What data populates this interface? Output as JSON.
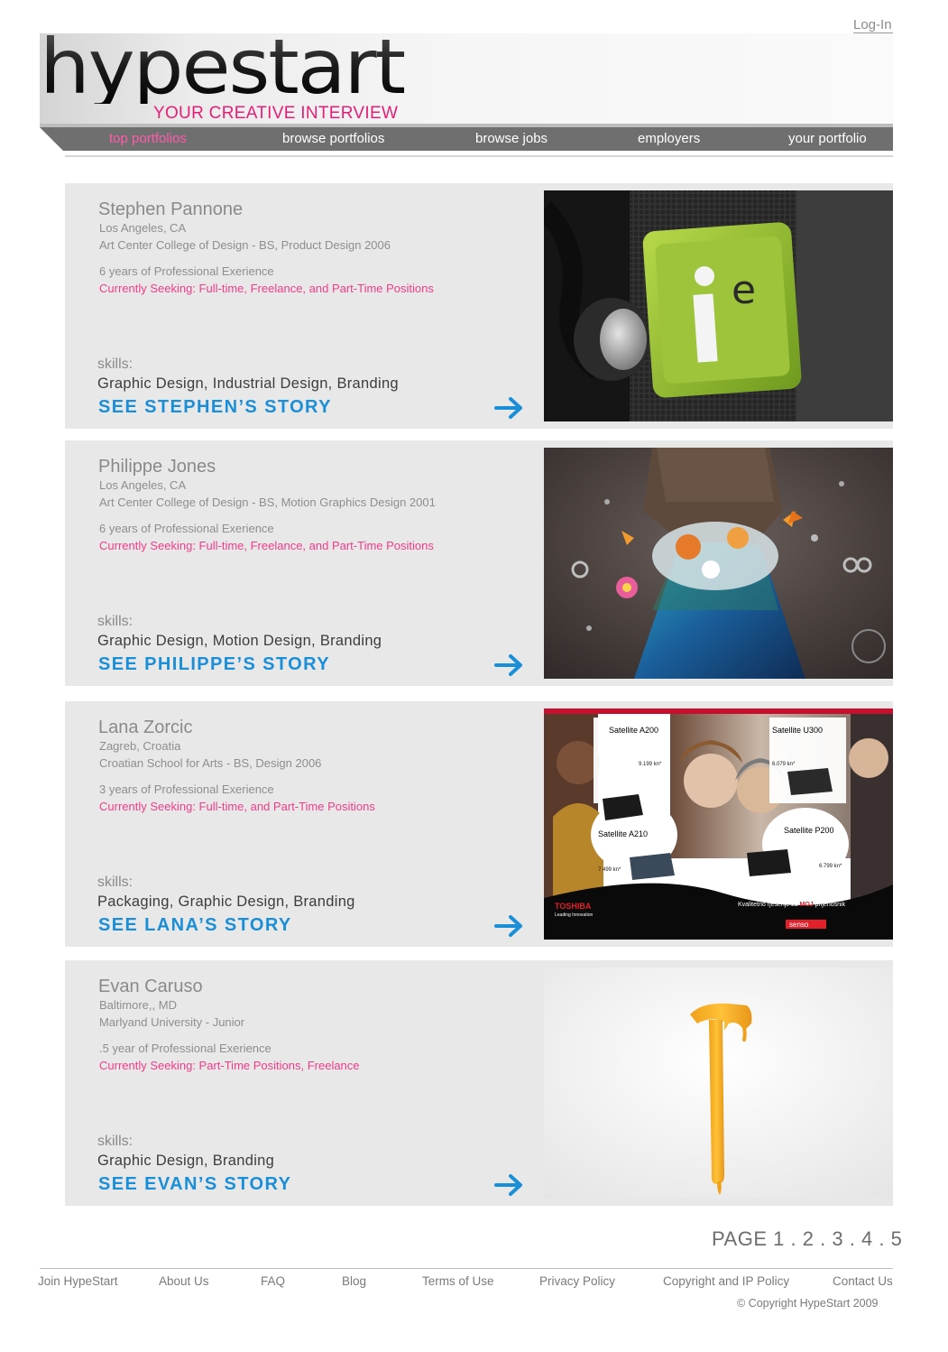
{
  "header": {
    "login_label": "Log-In",
    "logo_text": "hypestart",
    "tagline": "YOUR CREATIVE INTERVIEW"
  },
  "nav": {
    "items": [
      {
        "label": "top portfolios",
        "active": true
      },
      {
        "label": "browse portfolios",
        "active": false
      },
      {
        "label": "browse jobs",
        "active": false
      },
      {
        "label": "employers",
        "active": false
      },
      {
        "label": "your portfolio",
        "active": false
      }
    ]
  },
  "portfolios": [
    {
      "name": "Stephen Pannone",
      "location": "Los Angeles, CA",
      "school": "Art Center College of Design - BS, Product Design 2006",
      "experience": "6 years of Professional Exerience",
      "seeking": "Currently Seeking: Full-time, Freelance, and Part-Time Positions",
      "skills_label": "skills:",
      "skills": "Graphic Design, Industrial Design, Branding",
      "story_label": "SEE STEPHEN’S STORY",
      "image": "ie-product-photo"
    },
    {
      "name": "Philippe Jones",
      "location": "Los Angeles, CA",
      "school": "Art Center College of Design - BS, Motion Graphics Design 2001",
      "experience": "6 years of Professional Exerience",
      "seeking": "Currently Seeking: Full-time, Freelance, and Part-Time Positions",
      "skills_label": "skills:",
      "skills": "Graphic Design, Motion Design, Branding",
      "story_label": "SEE PHILIPPE’S STORY",
      "image": "butterfly-dress-artwork"
    },
    {
      "name": "Lana Zorcic",
      "location": "Zagreb, Croatia",
      "school": "Croatian School for Arts - BS, Design 2006",
      "experience": "3 years of Professional Exerience",
      "seeking": "Currently Seeking: Full-time, and Part-Time Positions",
      "skills_label": "skills:",
      "skills": "Packaging, Graphic Design, Branding",
      "story_label": "SEE LANA’S STORY",
      "image": "toshiba-ad-layout",
      "ad": {
        "models": [
          "Satellite A200",
          "Satellite U300",
          "Satellite A210",
          "Satellite P200"
        ],
        "prices": [
          "9.199 kn*",
          "6.079 kn*",
          "7.499 kn*",
          "6.799 kn*"
        ],
        "brand": "TOSHIBA",
        "brand_sub": "Leading Innovation",
        "slogan_pre": "Kvalitetno rješenje za ",
        "slogan_hl": "MOJ",
        "slogan_post": " prijenosnik",
        "partner": "senso"
      }
    },
    {
      "name": "Evan Caruso",
      "location": "Baltimore,, MD",
      "school": "Marlyand University - Junior",
      "experience": ".5 year of Professional Exerience",
      "seeking": "Currently Seeking: Part-Time Positions, Freelance",
      "skills_label": "skills:",
      "skills": "Graphic Design, Branding",
      "story_label": "SEE EVAN’S STORY",
      "image": "dripping-hammer-artwork"
    }
  ],
  "pager": {
    "prefix": "PAGE",
    "pages": [
      "1",
      "2",
      "3",
      "4",
      "5"
    ],
    "separator": "."
  },
  "footer": {
    "links": [
      "Join HypeStart",
      "About Us",
      "FAQ",
      "Blog",
      "Terms of Use",
      "Privacy Policy",
      "Copyright and IP Policy",
      "Contact Us"
    ],
    "copyright": "©  Copyright HypeStart 2009"
  },
  "colors": {
    "accent_pink": "#e61e78",
    "link_blue": "#1a8fd8",
    "nav_bar": "#6f6f6f",
    "card_bg": "#e8e8e8"
  }
}
